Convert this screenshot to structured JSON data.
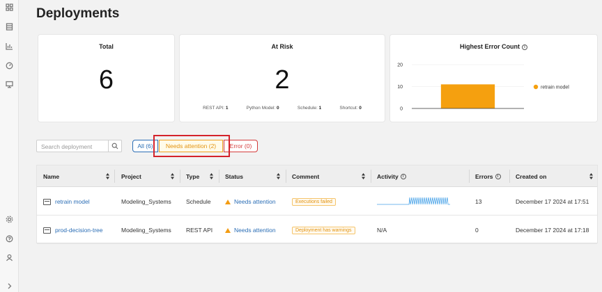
{
  "sidebar": {
    "icons": [
      "dashboard-icon",
      "list-icon",
      "chart-icon",
      "gauge-icon",
      "monitor-icon",
      "settings-icon",
      "help-icon",
      "user-icon",
      "expand-icon"
    ]
  },
  "page": {
    "title": "Deployments"
  },
  "cards": {
    "total": {
      "title": "Total",
      "value": "6"
    },
    "at_risk": {
      "title": "At Risk",
      "value": "2",
      "breakdown": [
        {
          "label": "REST API:",
          "value": "1"
        },
        {
          "label": "Python Model:",
          "value": "0"
        },
        {
          "label": "Schedule:",
          "value": "1"
        },
        {
          "label": "Shortcut:",
          "value": "0"
        }
      ]
    },
    "highest_error": {
      "title": "Highest Error Count"
    }
  },
  "chart_data": {
    "type": "bar",
    "title": "Highest Error Count",
    "categories": [
      "retrain model"
    ],
    "series": [
      {
        "name": "retrain model",
        "values": [
          11
        ]
      }
    ],
    "yticks": [
      "20",
      "10",
      "0"
    ],
    "ylim": [
      0,
      20
    ],
    "legend_position": "right",
    "colors": {
      "bar": "#f5a00f"
    }
  },
  "filters": {
    "search_placeholder": "Search deployment",
    "chips": {
      "all": "All (6)",
      "attention": "Needs attention (2)",
      "error": "Error (0)"
    }
  },
  "table": {
    "headers": {
      "name": "Name",
      "project": "Project",
      "type": "Type",
      "status": "Status",
      "comment": "Comment",
      "activity": "Activity",
      "errors": "Errors",
      "created": "Created on"
    },
    "rows": [
      {
        "name": "retrain model",
        "project": "Modeling_Systems",
        "type": "Schedule",
        "status": "Needs attention",
        "comment": "Executions failed",
        "activity": "",
        "errors": "13",
        "created": "December 17 2024 at 17:51"
      },
      {
        "name": "prod-decision-tree",
        "project": "Modeling_Systems",
        "type": "REST API",
        "status": "Needs attention",
        "comment": "Deployment has warnings",
        "activity": "N/A",
        "errors": "0",
        "created": "December 17 2024 at 17:18"
      }
    ]
  },
  "colors": {
    "accent": "#2a6db5",
    "warning": "#f39c12",
    "error": "#d43b3b",
    "highlight": "#d4232b"
  }
}
